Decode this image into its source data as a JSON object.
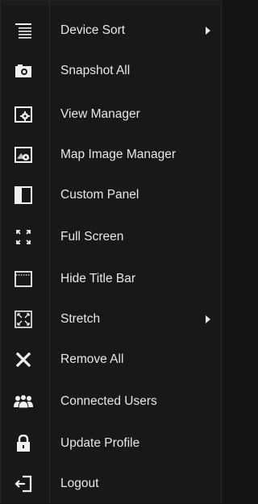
{
  "menu": {
    "items": [
      {
        "label": "Device Sort",
        "icon": "list-icon",
        "submenu": true
      },
      {
        "label": "Snapshot All",
        "icon": "camera-icon",
        "submenu": false
      },
      {
        "label": "View Manager",
        "icon": "view-manager-icon",
        "submenu": false
      },
      {
        "label": "Map Image Manager",
        "icon": "map-image-icon",
        "submenu": false
      },
      {
        "label": "Custom Panel",
        "icon": "custom-panel-icon",
        "submenu": false
      },
      {
        "label": "Full Screen",
        "icon": "fullscreen-icon",
        "submenu": false
      },
      {
        "label": "Hide Title Bar",
        "icon": "title-bar-icon",
        "submenu": false
      },
      {
        "label": "Stretch",
        "icon": "stretch-icon",
        "submenu": true
      },
      {
        "label": "Remove All",
        "icon": "close-icon",
        "submenu": false
      },
      {
        "label": "Connected Users",
        "icon": "users-icon",
        "submenu": false
      },
      {
        "label": "Update Profile",
        "icon": "lock-icon",
        "submenu": false
      },
      {
        "label": "Logout",
        "icon": "logout-icon",
        "submenu": false
      }
    ]
  }
}
